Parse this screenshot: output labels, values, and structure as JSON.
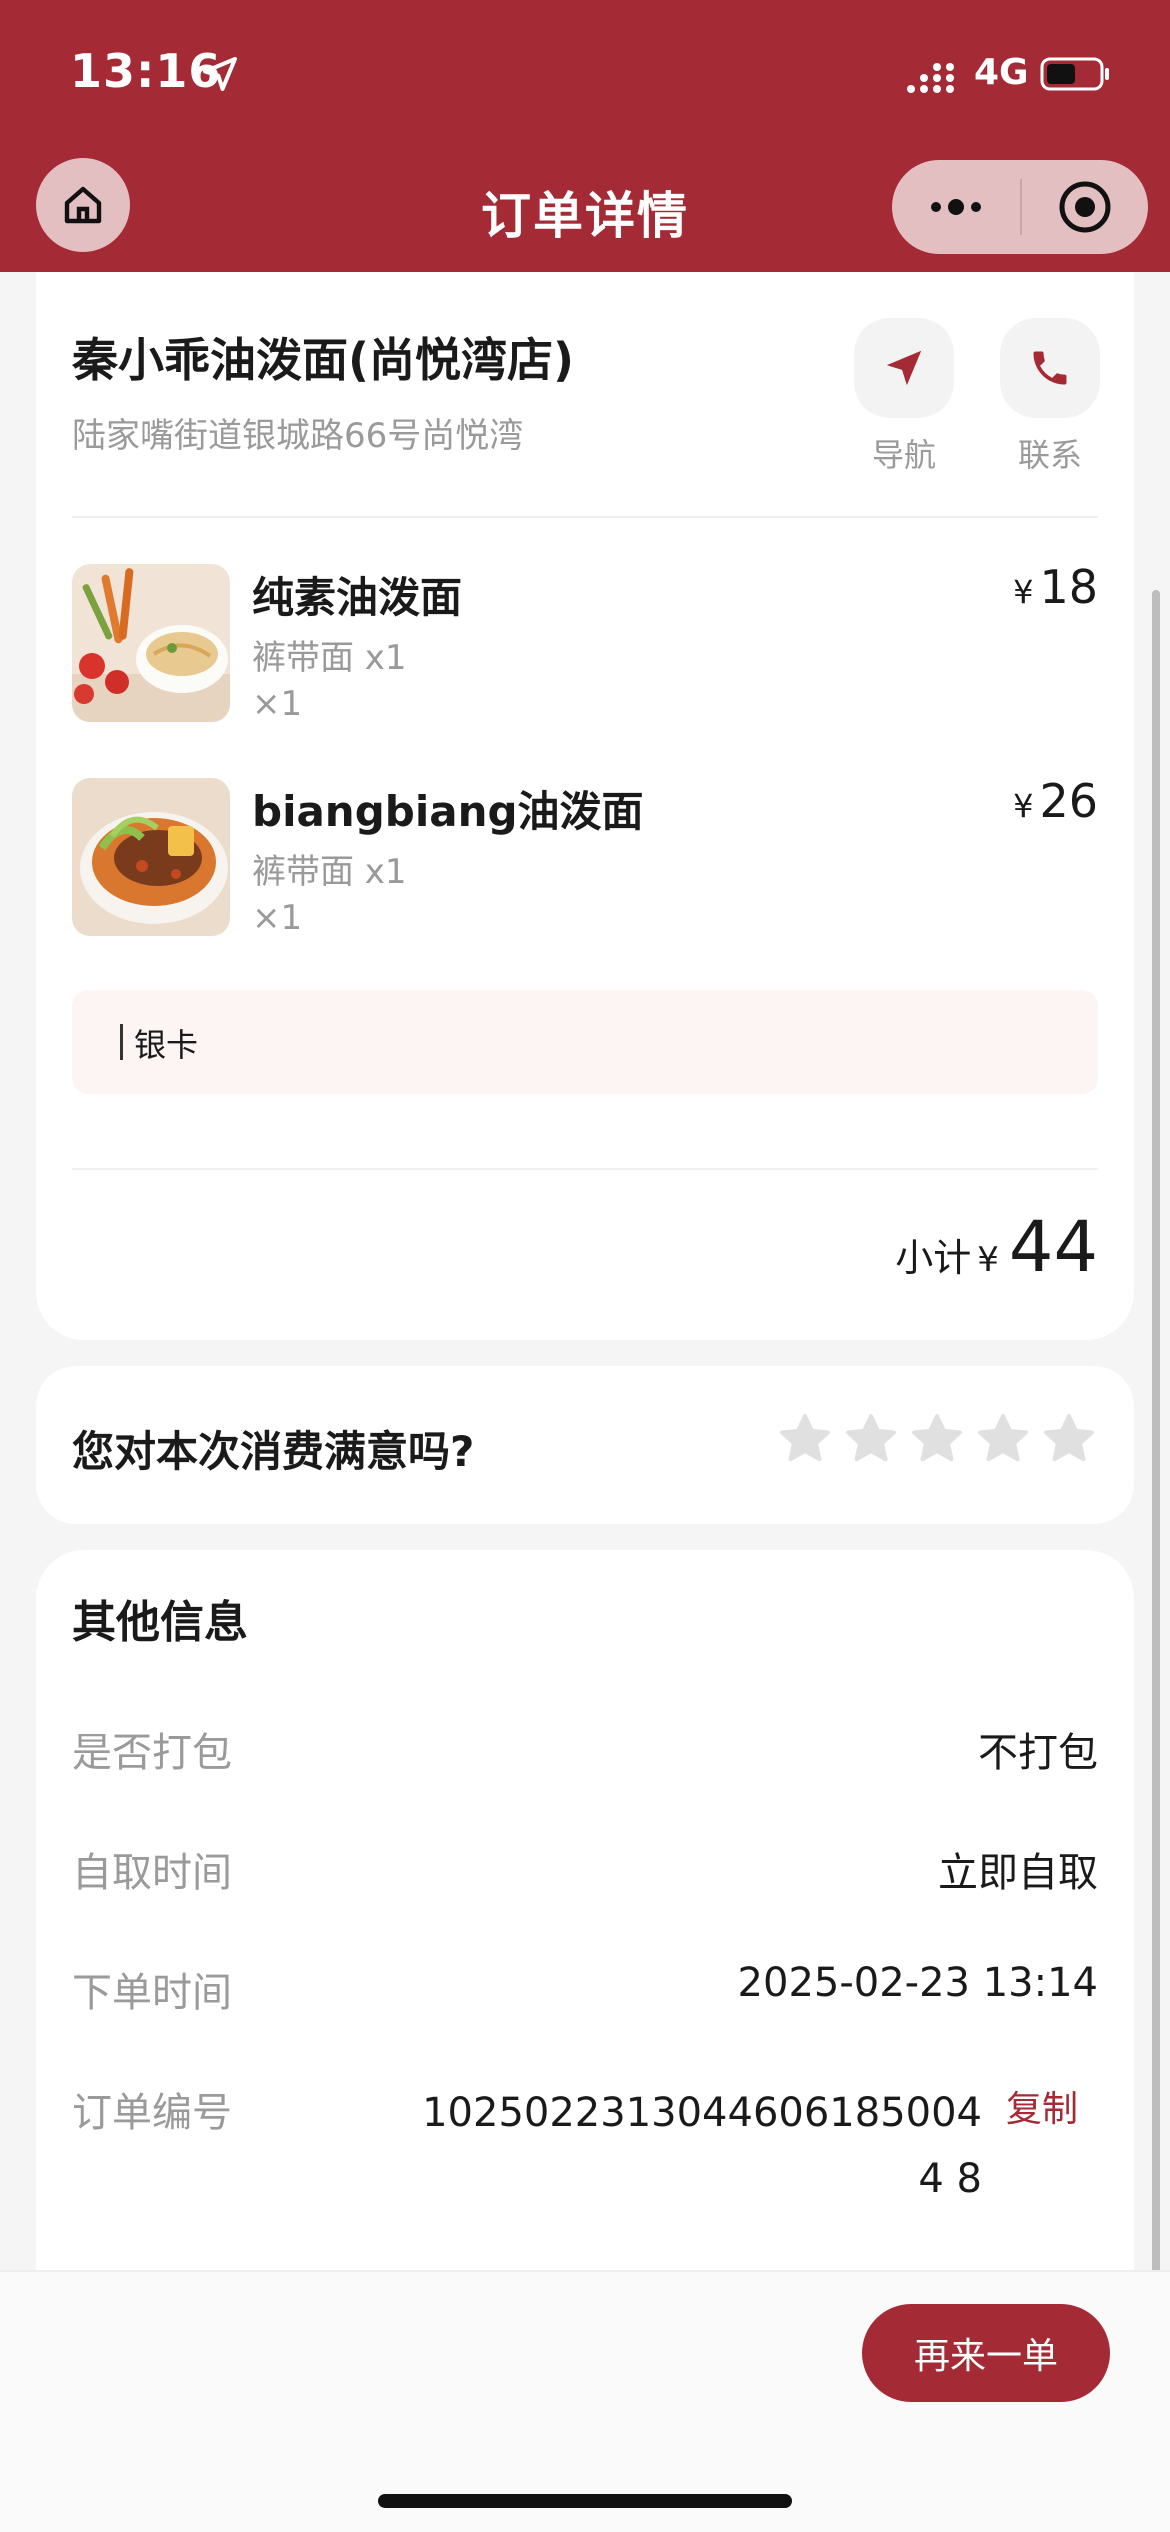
{
  "status": {
    "time": "13:16",
    "network": "4G"
  },
  "nav": {
    "title": "订单详情"
  },
  "store": {
    "name": "秦小乖油泼面(尚悦湾店)",
    "address": "陆家嘴街道银城路66号尚悦湾",
    "nav_label": "导航",
    "contact_label": "联系"
  },
  "items": [
    {
      "name": "纯素油泼面",
      "spec": "裤带面 x1",
      "qty": "×1",
      "currency": "¥",
      "price": "18"
    },
    {
      "name": "biangbiang油泼面",
      "spec": "裤带面 x1",
      "qty": "×1",
      "currency": "¥",
      "price": "26"
    }
  ],
  "note": "银卡",
  "subtotal": {
    "label": "小计",
    "currency": "¥",
    "amount": "44"
  },
  "rating": {
    "question": "您对本次消费满意吗?",
    "stars": 5,
    "selected": 0,
    "star_color": "#e0e0e0"
  },
  "other_info": {
    "title": "其他信息",
    "rows": [
      {
        "key": "是否打包",
        "value": "不打包"
      },
      {
        "key": "自取时间",
        "value": "立即自取"
      },
      {
        "key": "下单时间",
        "value": "2025-02-23 13:14"
      },
      {
        "key": "订单编号",
        "value": "10250223130446061850044 8"
      }
    ],
    "copy_label": "复制"
  },
  "bottom": {
    "reorder_label": "再来一单"
  },
  "colors": {
    "brand": "#a42b35",
    "muted": "#9a9a9a"
  }
}
